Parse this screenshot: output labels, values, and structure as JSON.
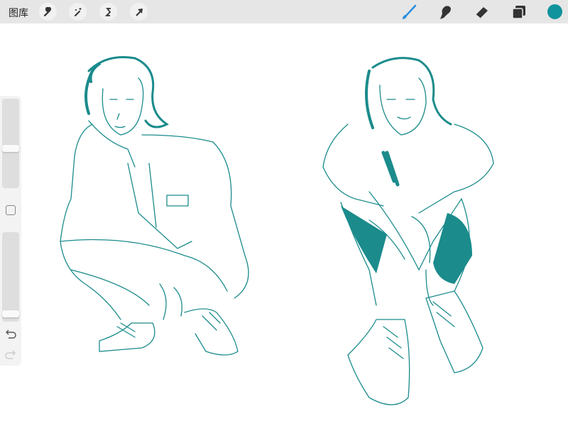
{
  "topbar": {
    "gallery_label": "图库",
    "left_tools": [
      {
        "name": "actions",
        "icon": "wrench-icon"
      },
      {
        "name": "adjustments",
        "icon": "magic-wand-icon"
      },
      {
        "name": "selection",
        "icon": "selection-s-icon"
      },
      {
        "name": "transform",
        "icon": "arrow-cursor-icon"
      }
    ],
    "right_tools": [
      {
        "name": "brush",
        "icon": "brush-icon",
        "active": true
      },
      {
        "name": "smudge",
        "icon": "smudge-finger-icon"
      },
      {
        "name": "eraser",
        "icon": "eraser-icon"
      },
      {
        "name": "layers",
        "icon": "layers-icon"
      }
    ],
    "current_color": "#11939d"
  },
  "sidebar": {
    "brush_size": 0.44,
    "opacity": 0.05
  },
  "colors": {
    "accent": "#2a8de0",
    "stroke": "#1b8b8c"
  }
}
